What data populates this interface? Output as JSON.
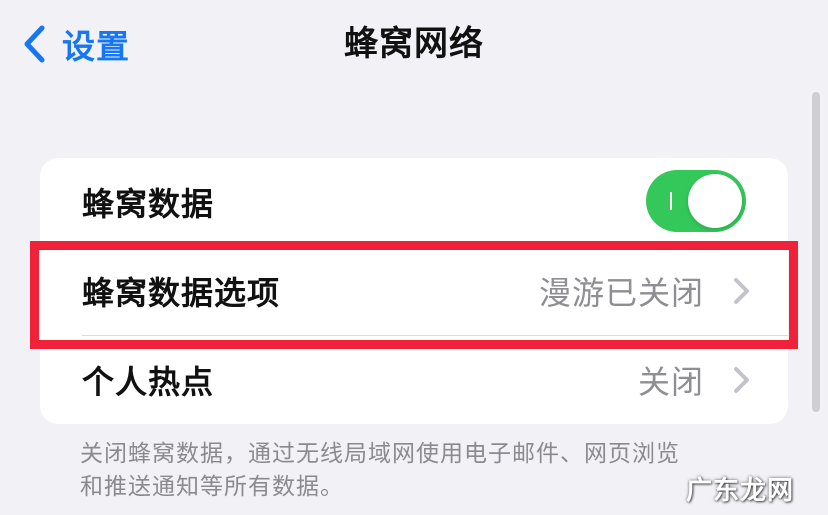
{
  "nav": {
    "back_label": "设置",
    "title": "蜂窝网络"
  },
  "settings": {
    "rows": [
      {
        "label": "蜂窝数据",
        "control": "toggle",
        "toggle_on": true
      },
      {
        "label": "蜂窝数据选项",
        "value": "漫游已关闭"
      },
      {
        "label": "个人热点",
        "value": "关闭"
      }
    ],
    "footer": "关闭蜂窝数据，通过无线局域网使用电子邮件、网页浏览和推送通知等所有数据。"
  },
  "watermark": "广东龙网",
  "colors": {
    "accent_blue": "#1677f5",
    "toggle_green": "#34c759",
    "highlight_red": "#f0223a",
    "background": "#f1f1f6"
  },
  "icons": {
    "back": "chevron-left-icon",
    "disclosure": "chevron-right-icon"
  }
}
